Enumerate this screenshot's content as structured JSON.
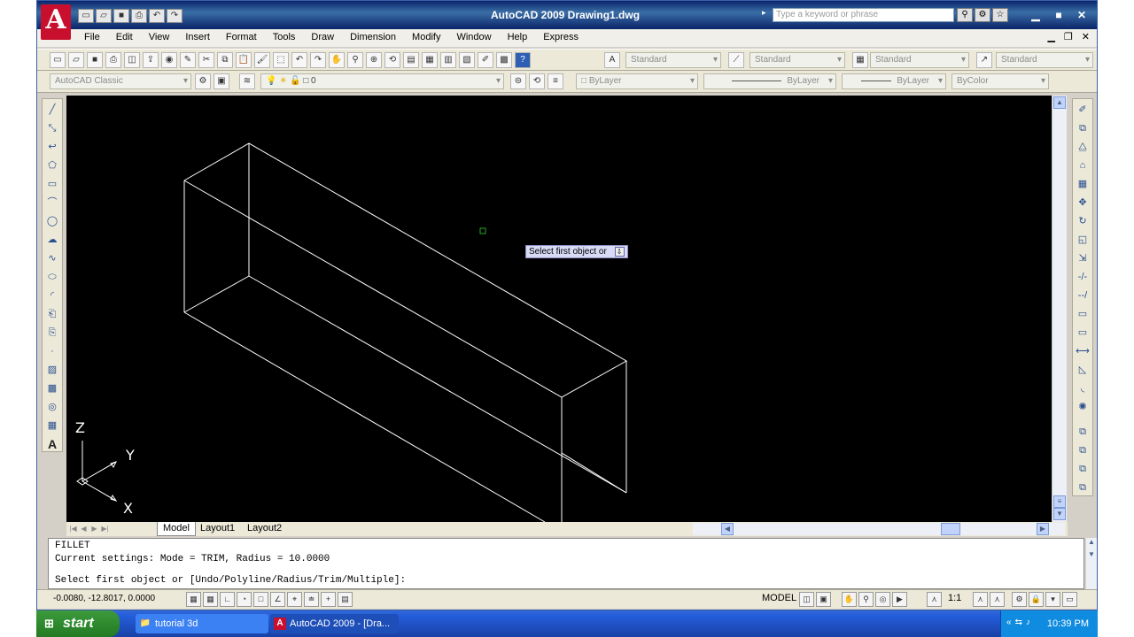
{
  "window": {
    "app_letter": "A",
    "title": "AutoCAD 2009 Drawing1.dwg",
    "search_placeholder": "Type a keyword or phrase",
    "menu": [
      "File",
      "Edit",
      "View",
      "Insert",
      "Format",
      "Tools",
      "Draw",
      "Dimension",
      "Modify",
      "Window",
      "Help",
      "Express"
    ]
  },
  "toolbar": {
    "text_style": "Standard",
    "dim_style": "Standard",
    "table_style": "Standard",
    "multileader_style": "Standard",
    "workspace": "AutoCAD Classic",
    "layer": "0",
    "color": "ByLayer",
    "linetype": "ByLayer",
    "lineweight": "ByLayer",
    "plot_style": "ByColor"
  },
  "canvas": {
    "tooltip": "Select first object or",
    "ucs": {
      "x": "X",
      "y": "Y",
      "z": "Z"
    }
  },
  "tabs": [
    "Model",
    "Layout1",
    "Layout2"
  ],
  "command": {
    "line1": "FILLET",
    "line2": "Current settings: Mode = TRIM, Radius = 10.0000",
    "prompt": "Select first object or [Undo/Polyline/Radius/Trim/Multiple]:"
  },
  "status": {
    "coords": "-0.0080, -12.8017, 0.0000",
    "space": "MODEL",
    "annotation_scale": "1:1"
  },
  "taskbar": {
    "start": "start",
    "items": [
      "tutorial 3d",
      "AutoCAD 2009 - [Dra..."
    ],
    "clock": "10:39 PM"
  },
  "colors": {
    "canvas": "#000000",
    "title_bar": "#0a246a",
    "logo": "#c8102e",
    "taskbar": "#245edb",
    "start": "#2f8a2f"
  }
}
